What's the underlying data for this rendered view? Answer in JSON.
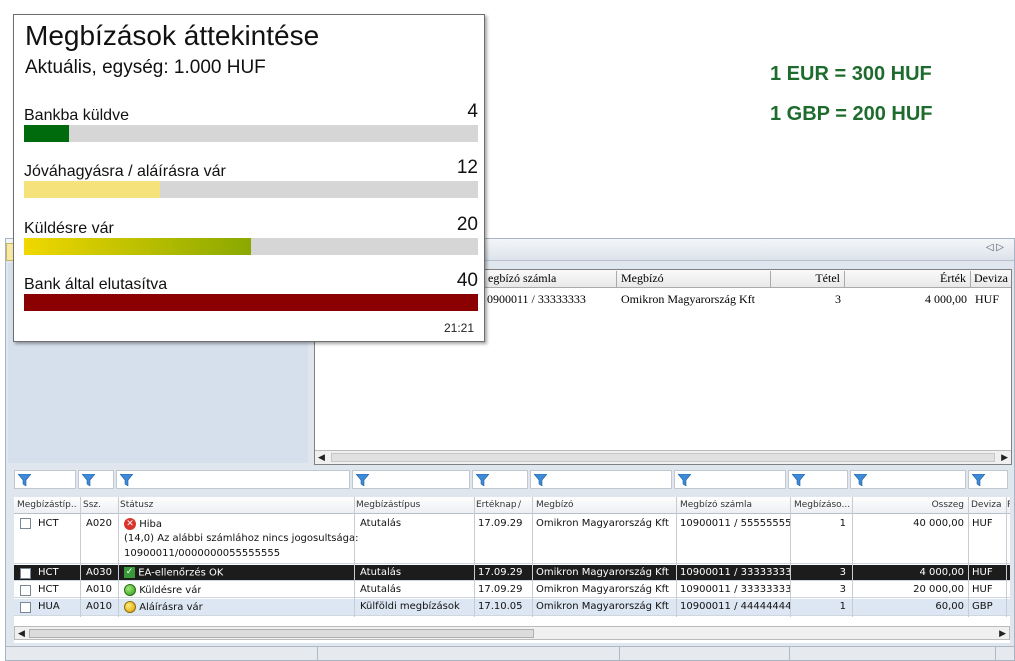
{
  "rates": {
    "eur": "1 EUR = 300 HUF",
    "gbp": "1 GBP = 200 HUF"
  },
  "overview": {
    "title": "Megbízások áttekintése",
    "subtitle": "Aktuális, egység: 1.000 HUF",
    "time": "21:21",
    "rows": [
      {
        "label": "Bankba küldve",
        "value": "4",
        "fill_fraction": 0.1,
        "color": "#006b0c"
      },
      {
        "label": "Jóváhagyásra / aláírásra vár",
        "value": "12",
        "fill_fraction": 0.3,
        "color": "#f5e27a"
      },
      {
        "label": "Küldésre vár",
        "value": "20",
        "fill_fraction": 0.5,
        "color": "#d7c400"
      },
      {
        "label": "Bank által elutasítva",
        "value": "40",
        "fill_fraction": 1.0,
        "color": "#8b0000"
      }
    ]
  },
  "upper_grid": {
    "headers": {
      "account": "egbízó számla",
      "payer": "Megbízó",
      "item": "Tétel",
      "value": "Érték",
      "currency": "Deviza"
    },
    "row": {
      "account": "0900011 / 33333333",
      "payer": "Omikron Magyarország Kft",
      "item": "3",
      "value": "4 000,00",
      "currency": "HUF"
    }
  },
  "lower_grid": {
    "headers": {
      "type_code": "Megbízástíp...",
      "seq": "Ssz.",
      "status": "Státusz",
      "type": "Megbízástípus",
      "value_date": "Értéknap",
      "sort_mark": "/",
      "payer": "Megbízó",
      "account": "Megbízó számla",
      "count": "Megbízáso...",
      "amount": "Összeg",
      "currency": "Deviza",
      "extra": "R"
    },
    "rows": [
      {
        "type_code": "HCT",
        "seq": "A020",
        "status": "Hiba",
        "status_icon": "error-icon",
        "status_detail_1": "(14,0) Az alábbi számlához nincs jogosultsága:",
        "status_detail_2": "10900011/0000000055555555",
        "type": "Átutalás",
        "value_date": "17.09.29",
        "payer": "Omikron Magyarország Kft",
        "account": "10900011 / 55555555",
        "count": "1",
        "amount": "40 000,00",
        "currency": "HUF"
      },
      {
        "type_code": "HCT",
        "seq": "A030",
        "status": "EA-ellenőrzés OK",
        "status_icon": "check-icon",
        "type": "Átutalás",
        "value_date": "17.09.29",
        "payer": "Omikron Magyarország Kft",
        "account": "10900011 / 33333333",
        "count": "3",
        "amount": "4 000,00",
        "currency": "HUF"
      },
      {
        "type_code": "HCT",
        "seq": "A010",
        "status": "Küldésre vár",
        "status_icon": "green-circle-icon",
        "type": "Átutalás",
        "value_date": "17.09.29",
        "payer": "Omikron Magyarország Kft",
        "account": "10900011 / 33333333",
        "count": "3",
        "amount": "20 000,00",
        "currency": "HUF"
      },
      {
        "type_code": "HUA",
        "seq": "A010",
        "status": "Aláírásra vár",
        "status_icon": "yellow-circle-icon",
        "type": "Külföldi megbízások",
        "value_date": "17.10.05",
        "payer": "Omikron Magyarország Kft",
        "account": "10900011 / 44444444",
        "count": "1",
        "amount": "60,00",
        "currency": "GBP"
      }
    ]
  }
}
